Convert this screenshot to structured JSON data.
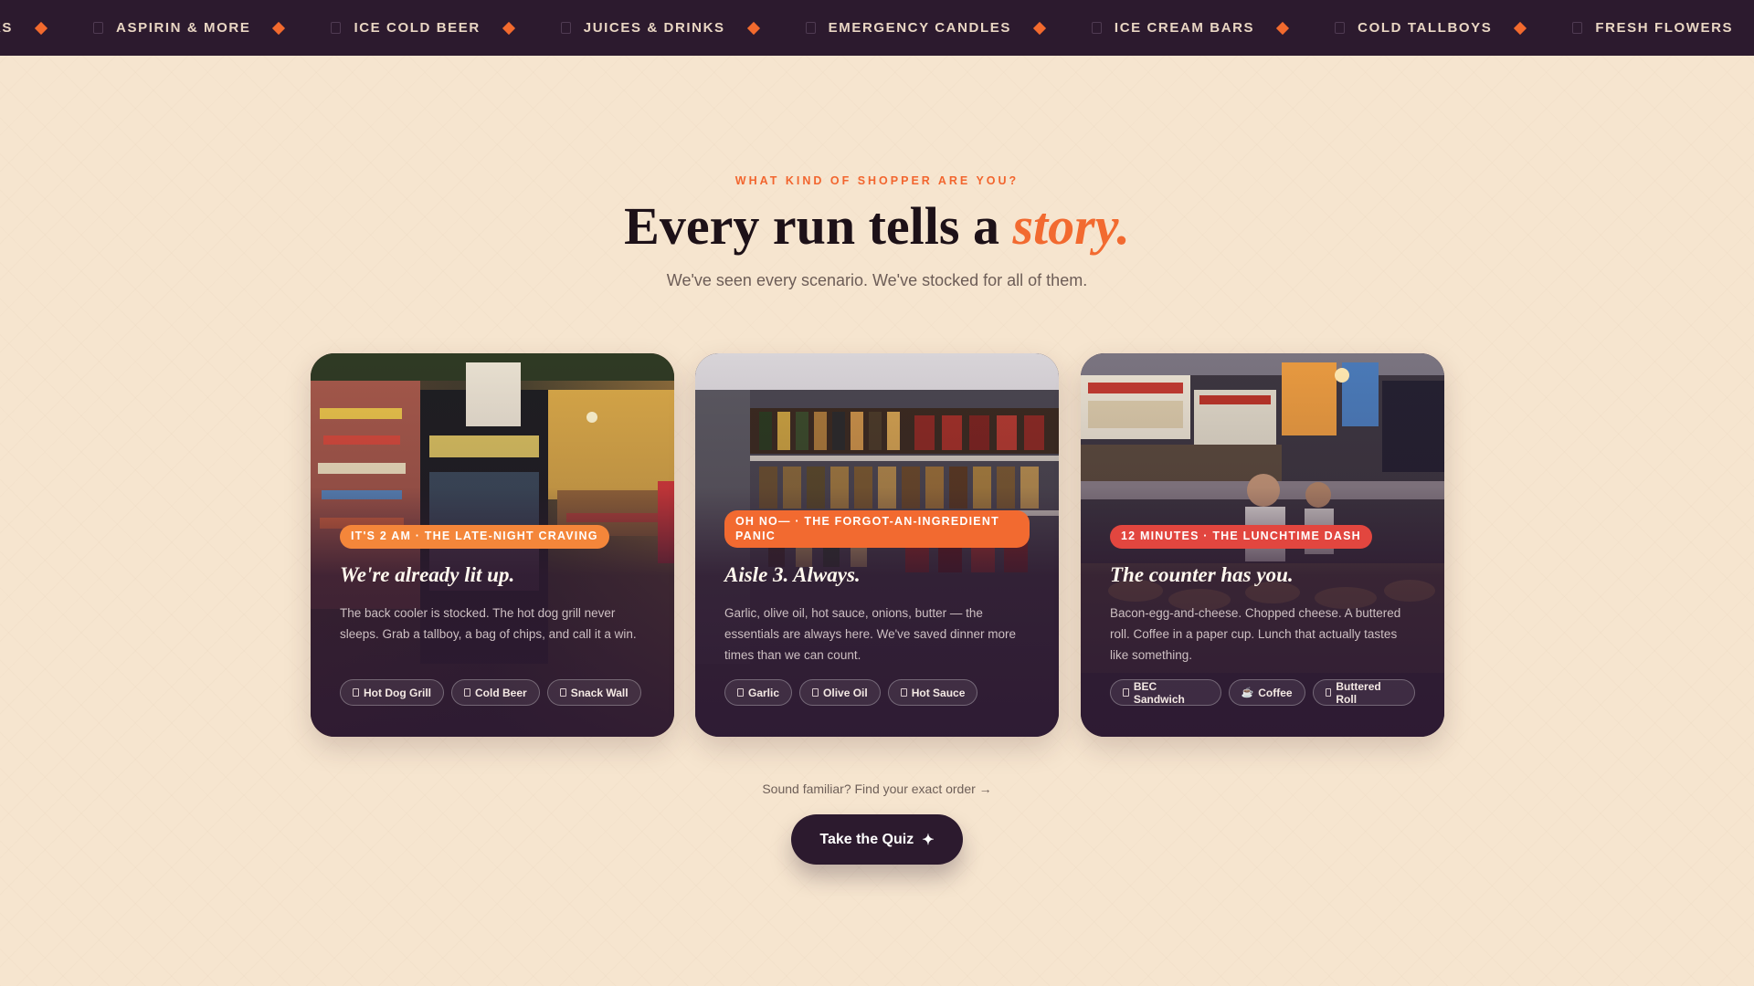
{
  "ticker": {
    "items": [
      {
        "label": "KS"
      },
      {
        "label": "ASPIRIN & MORE"
      },
      {
        "label": "ICE COLD BEER"
      },
      {
        "label": "JUICES & DRINKS"
      },
      {
        "label": "EMERGENCY CANDLES"
      },
      {
        "label": "ICE CREAM BARS"
      },
      {
        "label": "COLD TALLBOYS"
      },
      {
        "label": "FRESH FLOWERS"
      }
    ]
  },
  "hero": {
    "eyebrow": "WHAT KIND OF SHOPPER ARE YOU?",
    "title_main": "Every run tells a ",
    "title_accent": "story.",
    "subtitle": "We've seen every scenario. We've stocked for all of them."
  },
  "cards": [
    {
      "tag": "IT'S 2 AM · THE LATE-NIGHT CRAVING",
      "tag_color": "#f4863a",
      "title": "We're already lit up.",
      "description": "The back cooler is stocked. The hot dog grill never sleeps. Grab a tallboy, a bag of chips, and call it a win.",
      "chips": [
        {
          "icon": "box-icon",
          "label": "Hot Dog Grill"
        },
        {
          "icon": "box-icon",
          "label": "Cold Beer"
        },
        {
          "icon": "box-icon",
          "label": "Snack Wall"
        }
      ]
    },
    {
      "tag": "OH NO— · THE FORGOT-AN-INGREDIENT PANIC",
      "tag_color": "#f26a30",
      "title": "Aisle 3. Always.",
      "description": "Garlic, olive oil, hot sauce, onions, butter — the essentials are always here. We've saved dinner more times than we can count.",
      "chips": [
        {
          "icon": "box-icon",
          "label": "Garlic"
        },
        {
          "icon": "box-icon",
          "label": "Olive Oil"
        },
        {
          "icon": "box-icon",
          "label": "Hot Sauce"
        }
      ]
    },
    {
      "tag": "12 MINUTES · THE LUNCHTIME DASH",
      "tag_color": "#e2463f",
      "title": "The counter has you.",
      "description": "Bacon-egg-and-cheese. Chopped cheese. A buttered roll. Coffee in a paper cup. Lunch that actually tastes like something.",
      "chips": [
        {
          "icon": "box-icon",
          "label": "BEC Sandwich"
        },
        {
          "icon": "coffee-icon",
          "label": "Coffee"
        },
        {
          "icon": "box-icon",
          "label": "Buttered Roll"
        }
      ]
    }
  ],
  "cta": {
    "prompt": "Sound familiar? Find your exact order →",
    "button_label": "Take the Quiz",
    "button_icon": "✦"
  }
}
